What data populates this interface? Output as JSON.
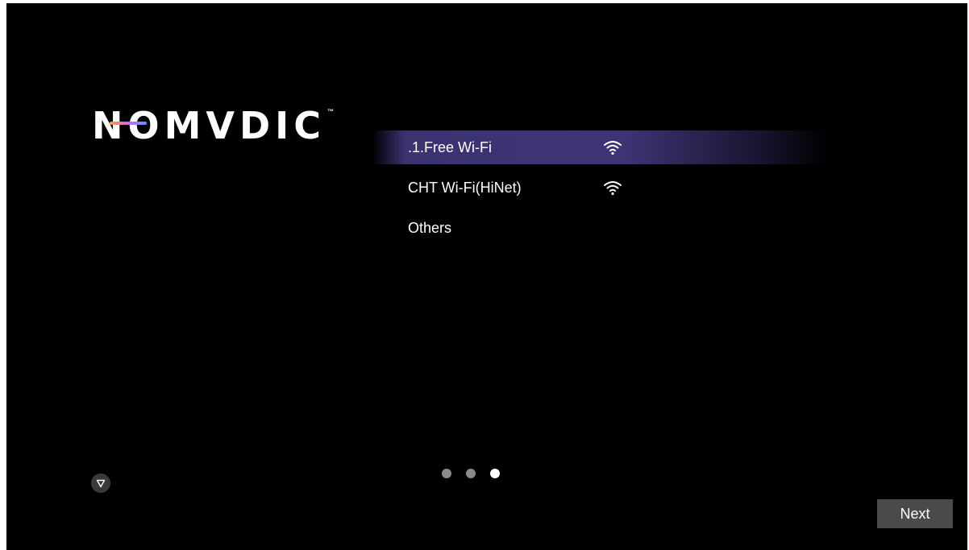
{
  "brand": {
    "logo_text": "NOMVDIC",
    "trademark": "™"
  },
  "networks": [
    {
      "name": ".1.Free Wi-Fi",
      "icon": "wifi-icon",
      "selected": true
    },
    {
      "name": "CHT Wi-Fi(HiNet)",
      "icon": "wifi-icon",
      "selected": false
    },
    {
      "name": "Others",
      "icon": null,
      "selected": false
    }
  ],
  "pagination": {
    "total": 3,
    "current": 3
  },
  "scroll_icon": "triangle-down-icon",
  "actions": {
    "next_label": "Next"
  },
  "colors": {
    "background": "#000000",
    "selected_row": "#3e3575",
    "button": "#4a4a4a"
  }
}
